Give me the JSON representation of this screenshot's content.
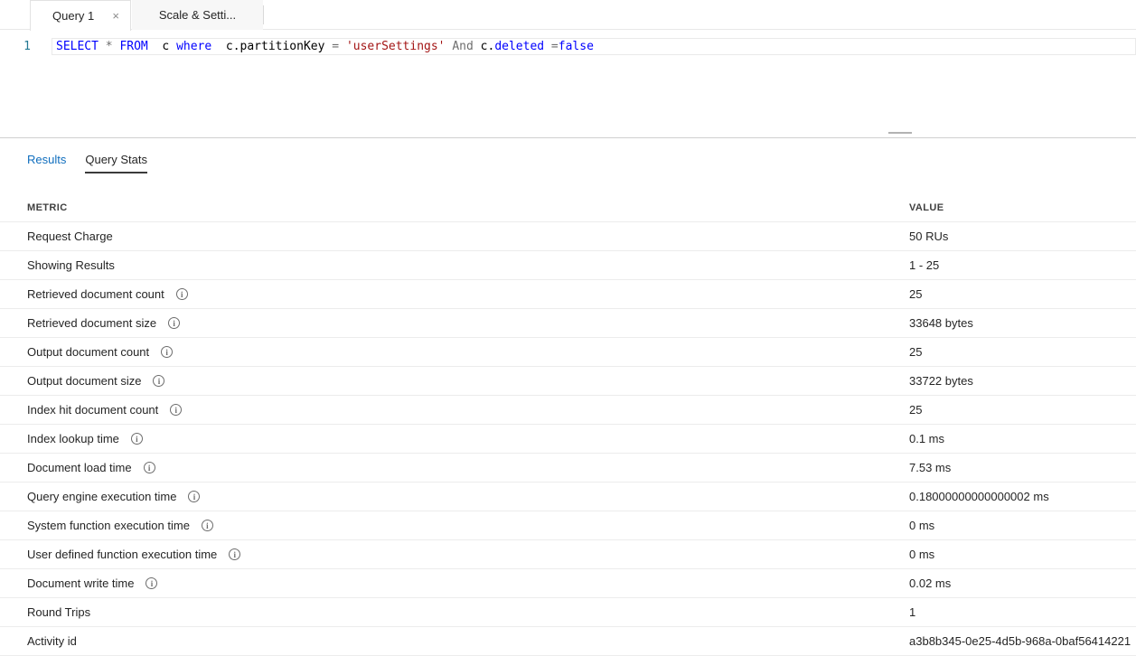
{
  "editor_tabs": [
    {
      "label": "Query 1",
      "active": true,
      "close_icon": "×"
    },
    {
      "label": "Scale & Setti...",
      "active": false
    }
  ],
  "query_editor": {
    "line_number": "1",
    "tokens": [
      {
        "text": "SELECT",
        "type": "keyword"
      },
      {
        "text": " ",
        "type": "plain"
      },
      {
        "text": "*",
        "type": "operator"
      },
      {
        "text": " ",
        "type": "plain"
      },
      {
        "text": "FROM",
        "type": "keyword"
      },
      {
        "text": "  c ",
        "type": "plain"
      },
      {
        "text": "where",
        "type": "keyword"
      },
      {
        "text": "  c.partitionKey ",
        "type": "plain"
      },
      {
        "text": "=",
        "type": "operator"
      },
      {
        "text": " ",
        "type": "plain"
      },
      {
        "text": "'userSettings'",
        "type": "string"
      },
      {
        "text": " ",
        "type": "plain"
      },
      {
        "text": "And",
        "type": "operator"
      },
      {
        "text": " c.",
        "type": "plain"
      },
      {
        "text": "deleted",
        "type": "keyword"
      },
      {
        "text": " =",
        "type": "operator"
      },
      {
        "text": "false",
        "type": "keyword"
      }
    ]
  },
  "results_pane": {
    "tabs": [
      {
        "label": "Results",
        "active": false
      },
      {
        "label": "Query Stats",
        "active": true
      }
    ]
  },
  "stats_table": {
    "columns": [
      "METRIC",
      "VALUE"
    ],
    "rows": [
      {
        "metric": "Request Charge",
        "value": "50 RUs",
        "info": false
      },
      {
        "metric": "Showing Results",
        "value": "1 - 25",
        "info": false
      },
      {
        "metric": "Retrieved document count",
        "value": "25",
        "info": true
      },
      {
        "metric": "Retrieved document size",
        "value": "33648 bytes",
        "info": true
      },
      {
        "metric": "Output document count",
        "value": "25",
        "info": true
      },
      {
        "metric": "Output document size",
        "value": "33722 bytes",
        "info": true
      },
      {
        "metric": "Index hit document count",
        "value": "25",
        "info": true
      },
      {
        "metric": "Index lookup time",
        "value": "0.1 ms",
        "info": true
      },
      {
        "metric": "Document load time",
        "value": "7.53 ms",
        "info": true
      },
      {
        "metric": "Query engine execution time",
        "value": "0.18000000000000002 ms",
        "info": true
      },
      {
        "metric": "System function execution time",
        "value": "0 ms",
        "info": true
      },
      {
        "metric": "User defined function execution time",
        "value": "0 ms",
        "info": true
      },
      {
        "metric": "Document write time",
        "value": "0.02 ms",
        "info": true
      },
      {
        "metric": "Round Trips",
        "value": "1",
        "info": false
      },
      {
        "metric": "Activity id",
        "value": "a3b8b345-0e25-4d5b-968a-0baf56414221",
        "info": false
      }
    ]
  },
  "colors": {
    "keyword": "#0000ff",
    "string": "#a31515",
    "operator": "#6e6e6e",
    "line_number": "#237893",
    "link_blue": "#106ebe",
    "active_tab_underline": "#3b3b3b",
    "row_divider": "#ececec"
  }
}
